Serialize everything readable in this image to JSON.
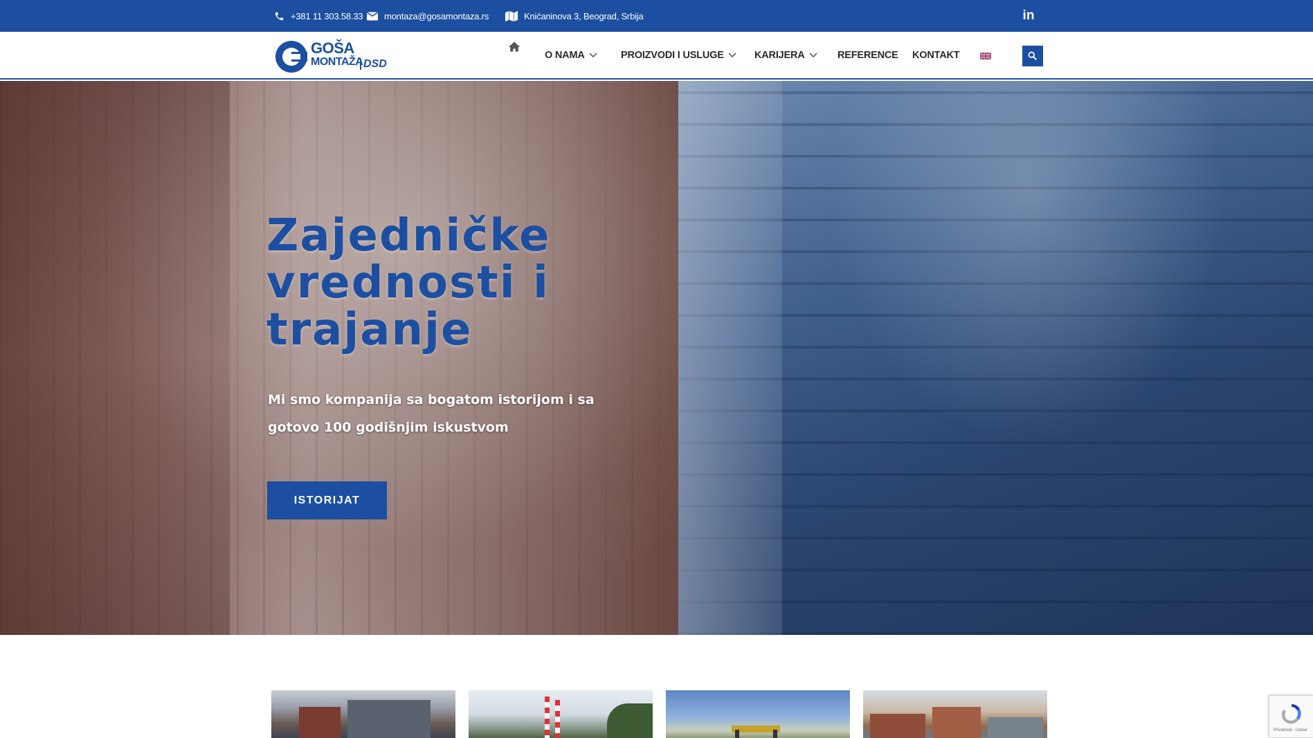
{
  "topbar": {
    "phone": "+381 11 303.58.33",
    "email": "montaza@gosamontaza.rs",
    "address": "Knićaninova 3, Beograd, Srbija",
    "social_icon": "linkedin-icon",
    "social_label": "in"
  },
  "logo": {
    "line1": "GOŠA",
    "line2": "MONTAŽA",
    "partner": "DSD"
  },
  "nav": {
    "home_icon": "home-icon",
    "items": [
      {
        "label": "O NAMA",
        "dropdown": true
      },
      {
        "label": "PROIZVODI I USLUGE",
        "dropdown": true
      },
      {
        "label": "KARIJERA",
        "dropdown": true
      },
      {
        "label": "REFERENCE",
        "dropdown": false
      },
      {
        "label": "KONTAKT",
        "dropdown": false
      }
    ],
    "language_icon": "uk-flag-icon",
    "search_icon": "search-icon"
  },
  "hero": {
    "title": "Zajedničke vrednosti i trajanje",
    "subtitle": "Mi smo kompanija sa bogatom istorijom i sa gotovo 100 godišnjim iskustvom",
    "button_label": "ISTORIJAT"
  },
  "recaptcha": {
    "footer": "Privatnost - Uslovi"
  },
  "colors": {
    "brand": "#1c4fa1",
    "nav_text": "#2a2a2a",
    "white": "#ffffff"
  }
}
